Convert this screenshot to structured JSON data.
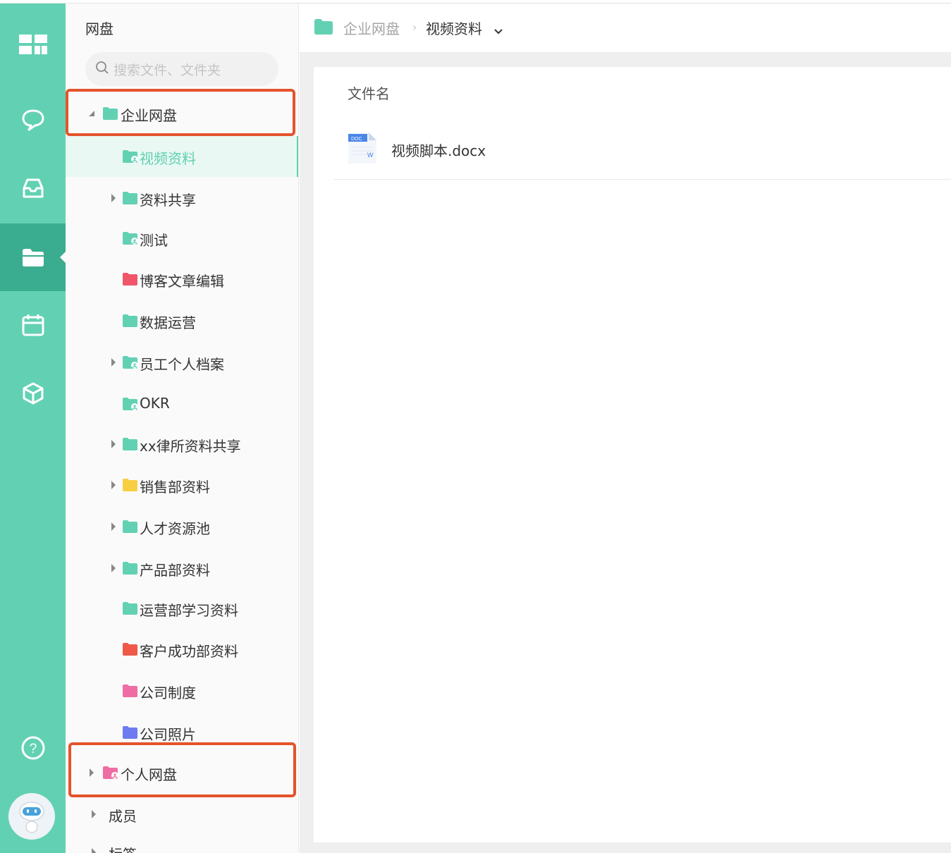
{
  "sidebar": {
    "title": "网盘",
    "search_placeholder": "搜索文件、文件夹",
    "items": [
      {
        "label": "企业网盘",
        "level": 0,
        "caret": "expanded",
        "folder_color": "#62d1b3",
        "shared": false
      },
      {
        "label": "视频资料",
        "level": 1,
        "caret": "none",
        "folder_color": "#62d1b3",
        "shared": true,
        "selected": true
      },
      {
        "label": "资料共享",
        "level": 1,
        "caret": "collapsed",
        "folder_color": "#62d1b3",
        "shared": false
      },
      {
        "label": "测试",
        "level": 1,
        "caret": "none",
        "folder_color": "#62d1b3",
        "shared": true
      },
      {
        "label": "博客文章编辑",
        "level": 1,
        "caret": "none",
        "folder_color": "#f0566a",
        "shared": false
      },
      {
        "label": "数据运营",
        "level": 1,
        "caret": "none",
        "folder_color": "#62d1b3",
        "shared": false
      },
      {
        "label": "员工个人档案",
        "level": 1,
        "caret": "collapsed",
        "folder_color": "#62d1b3",
        "shared": true
      },
      {
        "label": "OKR",
        "level": 1,
        "caret": "none",
        "folder_color": "#62d1b3",
        "shared": true
      },
      {
        "label": "xx律所资料共享",
        "level": 1,
        "caret": "collapsed",
        "folder_color": "#62d1b3",
        "shared": false
      },
      {
        "label": "销售部资料",
        "level": 1,
        "caret": "collapsed",
        "folder_color": "#f8cf43",
        "shared": false
      },
      {
        "label": "人才资源池",
        "level": 1,
        "caret": "collapsed",
        "folder_color": "#62d1b3",
        "shared": false
      },
      {
        "label": "产品部资料",
        "level": 1,
        "caret": "collapsed",
        "folder_color": "#62d1b3",
        "shared": false
      },
      {
        "label": "运营部学习资料",
        "level": 1,
        "caret": "none",
        "folder_color": "#62d1b3",
        "shared": false
      },
      {
        "label": "客户成功部资料",
        "level": 1,
        "caret": "none",
        "folder_color": "#ef5a48",
        "shared": false
      },
      {
        "label": "公司制度",
        "level": 1,
        "caret": "none",
        "folder_color": "#ee6ea3",
        "shared": false
      },
      {
        "label": "公司照片",
        "level": 1,
        "caret": "none",
        "folder_color": "#6e7cf0",
        "shared": false
      },
      {
        "label": "个人网盘",
        "level": 0,
        "caret": "collapsed",
        "folder_color": "#ee6ea3",
        "shared": true
      },
      {
        "label": "成员",
        "level": -1,
        "caret": "collapsed"
      },
      {
        "label": "标签",
        "level": -1,
        "caret": "collapsed"
      }
    ]
  },
  "rail": {
    "icons": [
      "dashboard-icon",
      "chat-icon",
      "inbox-icon",
      "folder-icon",
      "calendar-icon",
      "cube-icon",
      "help-icon",
      "robot-avatar-icon"
    ],
    "active": "folder-icon",
    "color": "#62d1b3",
    "active_color": "#3aac8f"
  },
  "breadcrumb": {
    "root": "企业网盘",
    "separator": "›",
    "current": "视频资料"
  },
  "file_list": {
    "column_header": "文件名",
    "files": [
      {
        "name": "视频脚本.docx",
        "icon": "docx-file-icon",
        "badge": "DOC"
      }
    ]
  },
  "accent_color": "#62d1b3",
  "highlight_color": "#e5532b"
}
